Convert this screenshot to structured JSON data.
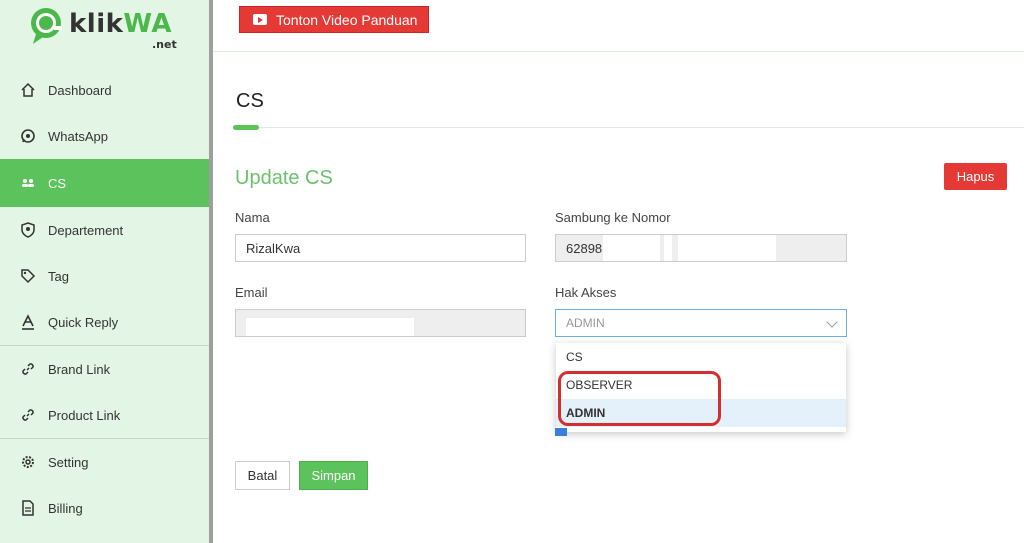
{
  "brand": {
    "name_part1": "klik",
    "name_part2": "WA",
    "suffix": ".net",
    "color_green": "#4cb84c"
  },
  "sidebar": {
    "items": [
      {
        "label": "Dashboard",
        "icon": "home-icon"
      },
      {
        "label": "WhatsApp",
        "icon": "whatsapp-icon"
      },
      {
        "label": "CS",
        "icon": "people-icon",
        "active": true
      },
      {
        "label": "Departement",
        "icon": "shield-user-icon"
      },
      {
        "label": "Tag",
        "icon": "tag-icon"
      },
      {
        "label": "Quick Reply",
        "icon": "text-a-icon"
      },
      {
        "label": "Brand Link",
        "icon": "link-icon"
      },
      {
        "label": "Product Link",
        "icon": "link-icon"
      },
      {
        "label": "Setting",
        "icon": "gear-icon"
      },
      {
        "label": "Billing",
        "icon": "document-icon"
      }
    ]
  },
  "topbar": {
    "video_button": "Tonton Video Panduan"
  },
  "page": {
    "title": "CS"
  },
  "form": {
    "title": "Update CS",
    "delete_button": "Hapus",
    "nama_label": "Nama",
    "nama_value": "RizalKwa",
    "nomor_label": "Sambung ke Nomor",
    "nomor_value": "62898",
    "email_label": "Email",
    "akses_label": "Hak Akses",
    "akses_value": "ADMIN",
    "akses_options": [
      "CS",
      "OBSERVER",
      "ADMIN"
    ],
    "cancel_button": "Batal",
    "save_button": "Simpan"
  },
  "colors": {
    "accent": "#5cc25c",
    "danger": "#e53935",
    "sidebar_bg": "#e3f5e4"
  }
}
